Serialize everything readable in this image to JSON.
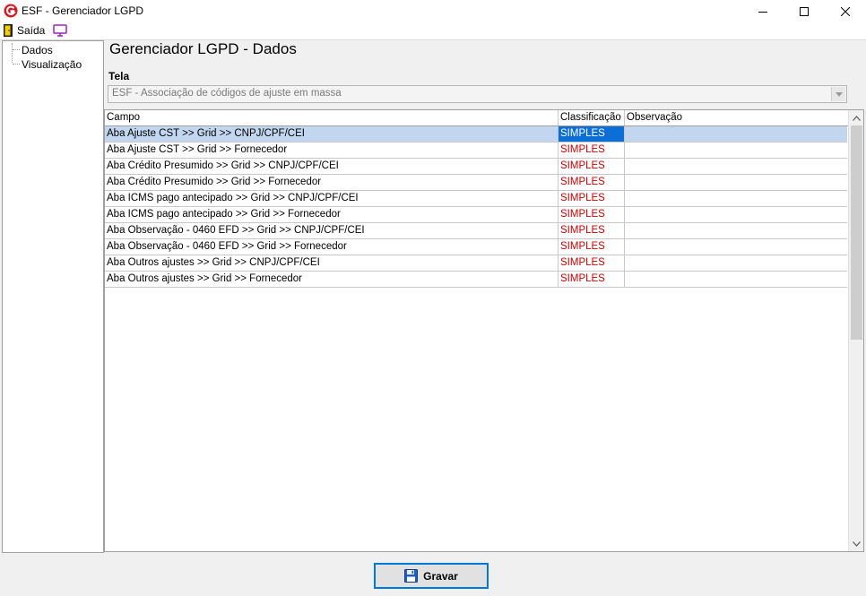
{
  "window": {
    "title": "ESF - Gerenciador LGPD",
    "controls": {
      "minimize": "minimize-icon",
      "maximize": "maximize-icon",
      "close": "close-icon"
    }
  },
  "menubar": {
    "exit_label": "Saída",
    "exit_icon": "exit-door-icon",
    "screen_icon": "monitor-icon"
  },
  "tree": {
    "items": [
      {
        "label": "Dados"
      },
      {
        "label": "Visualização"
      }
    ]
  },
  "page": {
    "title": "Gerenciador LGPD - Dados",
    "screen_label": "Tela",
    "screen_value": "ESF - Associação de códigos de ajuste em massa"
  },
  "grid": {
    "columns": [
      "Campo",
      "Classificação",
      "Observação"
    ],
    "rows": [
      {
        "campo": "Aba Ajuste CST >> Grid >> CNPJ/CPF/CEI",
        "classificacao": "SIMPLES",
        "observacao": "",
        "selected": true
      },
      {
        "campo": "Aba Ajuste CST >> Grid >> Fornecedor",
        "classificacao": "SIMPLES",
        "observacao": ""
      },
      {
        "campo": "Aba Crédito Presumido >> Grid >> CNPJ/CPF/CEI",
        "classificacao": "SIMPLES",
        "observacao": ""
      },
      {
        "campo": "Aba Crédito Presumido >> Grid >> Fornecedor",
        "classificacao": "SIMPLES",
        "observacao": ""
      },
      {
        "campo": "Aba ICMS pago antecipado >> Grid >> CNPJ/CPF/CEI",
        "classificacao": "SIMPLES",
        "observacao": ""
      },
      {
        "campo": "Aba ICMS pago antecipado >> Grid >> Fornecedor",
        "classificacao": "SIMPLES",
        "observacao": ""
      },
      {
        "campo": "Aba Observação - 0460 EFD >> Grid >> CNPJ/CPF/CEI",
        "classificacao": "SIMPLES",
        "observacao": ""
      },
      {
        "campo": "Aba Observação - 0460 EFD >> Grid >> Fornecedor",
        "classificacao": "SIMPLES",
        "observacao": ""
      },
      {
        "campo": "Aba Outros ajustes >> Grid >> CNPJ/CPF/CEI",
        "classificacao": "SIMPLES",
        "observacao": ""
      },
      {
        "campo": "Aba Outros ajustes >> Grid >> Fornecedor",
        "classificacao": "SIMPLES",
        "observacao": ""
      }
    ]
  },
  "footer": {
    "save_label": "Gravar",
    "save_icon": "floppy-disk-icon"
  },
  "colors": {
    "selection_row": "#c2d6f0",
    "selection_cell": "#0d6fd6",
    "classification_text": "#d00000",
    "button_focus_border": "#0078d7"
  }
}
